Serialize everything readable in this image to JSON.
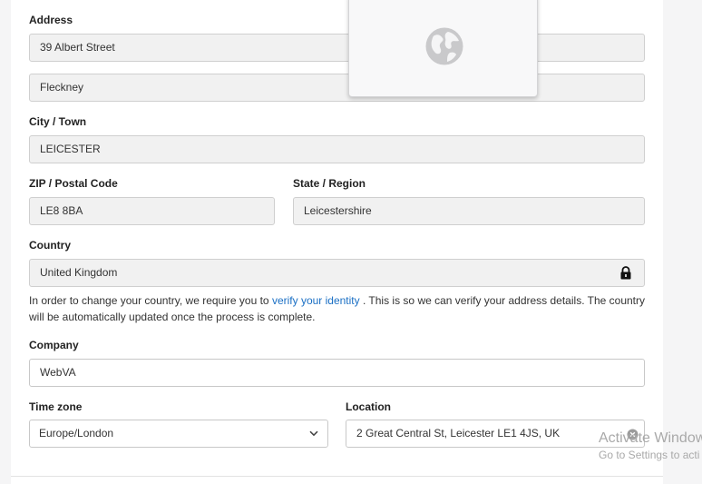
{
  "address": {
    "label": "Address",
    "line1": "39 Albert Street",
    "line2": "Fleckney"
  },
  "city": {
    "label": "City / Town",
    "value": "LEICESTER"
  },
  "postal": {
    "label": "ZIP / Postal Code",
    "value": "LE8 8BA"
  },
  "state": {
    "label": "State / Region",
    "value": "Leicestershire"
  },
  "country": {
    "label": "Country",
    "value": "United Kingdom",
    "icon": "lock-icon",
    "help_before": "In order to change your country, we require you to ",
    "help_link": "verify your identity",
    "help_after": " . This is so we can verify your address details. The country will be automatically updated once the process is complete."
  },
  "company": {
    "label": "Company",
    "value": "WebVA"
  },
  "timezone": {
    "label": "Time zone",
    "value": "Europe/London",
    "icon": "chevron-down-icon"
  },
  "location": {
    "label": "Location",
    "value": "2 Great Central St, Leicester LE1 4JS, UK",
    "icon": "clear-icon"
  },
  "popup": {
    "icon": "globe-icon"
  },
  "watermark": {
    "line1": "Activate Window",
    "line2": "Go to Settings to acti"
  },
  "colors": {
    "link": "#1a6fc4",
    "field_bg": "#f1f1f1",
    "border": "#cfcfcf"
  }
}
